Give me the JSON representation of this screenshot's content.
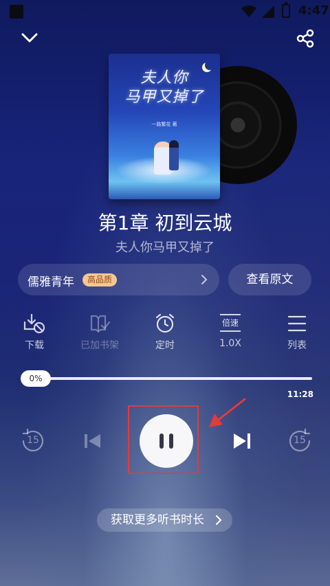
{
  "status_bar": {
    "time": "4:47"
  },
  "header": {
    "collapse_icon": "chevron-down-icon",
    "share_icon": "share-icon"
  },
  "cover": {
    "title_line1": "夫人你",
    "title_line2": "马甲又掉了",
    "author": "一路繁花 著"
  },
  "chapter_title": "第1章 初到云城",
  "book_name": "夫人你马甲又掉了",
  "voice": {
    "name": "儒雅青年",
    "quality_badge": "高品质",
    "original_label": "查看原文"
  },
  "functions": [
    {
      "label": "下载",
      "icon": "download-off-icon",
      "enabled": true
    },
    {
      "label": "已加书架",
      "icon": "bookshelf-check-icon",
      "enabled": false
    },
    {
      "label": "定时",
      "icon": "alarm-clock-icon",
      "enabled": true
    },
    {
      "label": "1.0X",
      "icon": "speed-icon",
      "enabled": true,
      "icon_text": "倍速"
    },
    {
      "label": "列表",
      "icon": "list-icon",
      "enabled": true
    }
  ],
  "progress": {
    "percent_label": "0%",
    "fraction": 0.0,
    "duration": "11:28"
  },
  "controls": {
    "rewind_seconds": "15",
    "forward_seconds": "15"
  },
  "more_listen_label": "获取更多听书时长",
  "colors": {
    "highlight_box": "#e23b3b",
    "quality_badge_bg": "#f6c792",
    "quality_badge_text": "#8a4b12"
  }
}
